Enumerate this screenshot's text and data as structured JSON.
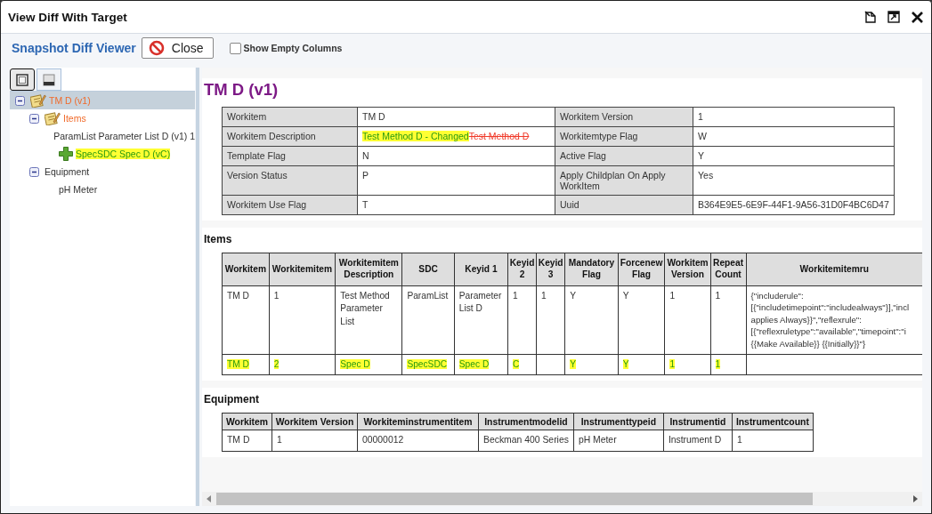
{
  "window": {
    "title": "View Diff With Target"
  },
  "toolbar": {
    "title": "Snapshot Diff Viewer",
    "close_button": "Close",
    "show_empty_columns": {
      "label": "Show Empty Columns",
      "checked": false
    }
  },
  "tree_view_buttons": [
    {
      "selected": true
    },
    {
      "selected": false
    }
  ],
  "tree": [
    {
      "label": "TM D (v1)",
      "kind": "changed",
      "selected": true,
      "expanded": true,
      "children": [
        {
          "label": "Items",
          "kind": "changed",
          "selected": false,
          "expanded": true,
          "children": [
            {
              "label": "ParamList Parameter List D (v1) 1",
              "kind": "same",
              "selected": false
            },
            {
              "label": "SpecSDC Spec D (vC)",
              "kind": "added",
              "selected": false
            }
          ]
        },
        {
          "label": "Equipment",
          "kind": "same",
          "selected": false,
          "expanded": true,
          "children": [
            {
              "label": "pH Meter",
              "kind": "same",
              "selected": false
            }
          ]
        }
      ]
    }
  ],
  "detail": {
    "heading": "TM D (v1)",
    "rows": [
      [
        {
          "label": "Workitem",
          "value": "TM D"
        },
        {
          "label": "Workitem Version",
          "value": "1"
        }
      ],
      [
        {
          "label": "Workitem Description",
          "value": "Test Method D - Changed",
          "old_value": "Test Method D"
        },
        {
          "label": "Workitemtype Flag",
          "value": "W"
        }
      ],
      [
        {
          "label": "Template Flag",
          "value": "N"
        },
        {
          "label": "Active Flag",
          "value": "Y"
        }
      ],
      [
        {
          "label": "Version Status",
          "value": "P"
        },
        {
          "label": "Apply Childplan On Apply WorkItem",
          "value": "Yes"
        }
      ],
      [
        {
          "label": "Workitem Use Flag",
          "value": "T"
        },
        {
          "label": "Uuid",
          "value": "B364E9E5-6E9F-44F1-9A56-31D0F4BC6D47"
        }
      ]
    ]
  },
  "items": {
    "heading": "Items",
    "columns": [
      "Workitem",
      "Workitemitem",
      "Workitemitem Description",
      "SDC",
      "Keyid 1",
      "Keyid 2",
      "Keyid 3",
      "Mandatory Flag",
      "Forcenew Flag",
      "Workitem Version",
      "Repeat Count",
      "Workitemitemru"
    ],
    "rows": [
      {
        "kind": "same",
        "cells": [
          "TM D",
          "1",
          "Test Method Parameter List",
          "ParamList",
          "Parameter List D",
          "1",
          "1",
          "Y",
          "Y",
          "1",
          "1",
          "{\"includerule\":\n[{\"includetimepoint\":\"includealways\"}],\"incl\napplies Always}}\",\"reflexrule\":\n[{\"reflexruletype\":\"available\",\"timepoint\":\"i\n{{Make Available}} {{Initially}}\"}"
        ]
      },
      {
        "kind": "added",
        "cells": [
          "TM D",
          "2",
          "Spec D",
          "SpecSDC",
          "Spec D",
          "C",
          "",
          "Y",
          "Y",
          "1",
          "1"
        ]
      }
    ]
  },
  "equipment": {
    "heading": "Equipment",
    "columns": [
      "Workitem",
      "Workitem Version",
      "Workiteminstrumentitem",
      "Instrumentmodelid",
      "Instrumenttypeid",
      "Instrumentid",
      "Instrumentcount"
    ],
    "rows": [
      {
        "cells": [
          "TM D",
          "1",
          "00000012",
          "Beckman 400 Series",
          "pH Meter",
          "Instrument D",
          "1"
        ]
      }
    ]
  }
}
